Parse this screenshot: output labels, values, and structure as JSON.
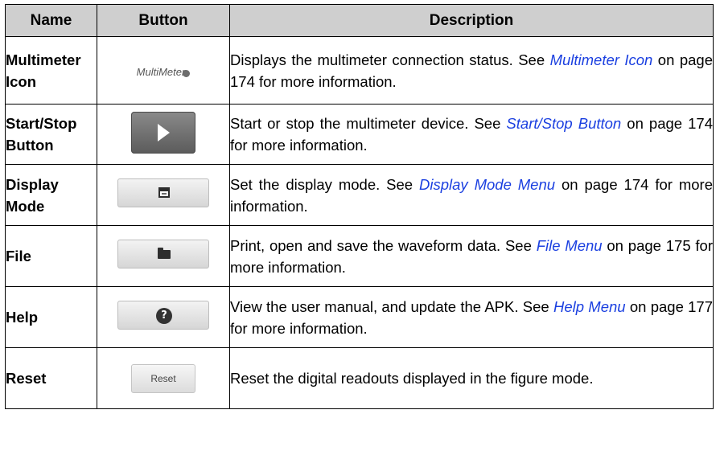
{
  "header": {
    "name": "Name",
    "button": "Button",
    "description": "Description"
  },
  "rows": [
    {
      "name": "Multimeter Icon",
      "button": {
        "kind": "multimeter-icon",
        "label": "MultiMeter"
      },
      "desc_pre": "Displays the multimeter connection status. See ",
      "link": "Multimeter Icon",
      "desc_post": " on page 174 for more information."
    },
    {
      "name": "Start/Stop Button",
      "button": {
        "kind": "play-icon"
      },
      "desc_pre": "Start or stop the multimeter device. See ",
      "link": "Start/Stop Button",
      "desc_post": " on page 174 for more information."
    },
    {
      "name": "Display Mode",
      "button": {
        "kind": "display-mode-icon"
      },
      "desc_pre": "Set the display mode. See ",
      "link": "Display Mode Menu",
      "desc_post": " on page 174 for more information."
    },
    {
      "name": "File",
      "button": {
        "kind": "folder-icon"
      },
      "desc_pre": "Print, open and save the waveform data. See ",
      "link": "File Menu",
      "desc_post": " on page 175 for more information."
    },
    {
      "name": "Help",
      "button": {
        "kind": "help-icon",
        "glyph": "?"
      },
      "desc_pre": "View the user manual, and update the APK. See ",
      "link": "Help Menu",
      "desc_post": " on page 177 for more information."
    },
    {
      "name": "Reset",
      "button": {
        "kind": "reset-button",
        "label": "Reset"
      },
      "desc_pre": "Reset the digital readouts displayed in the figure mode.",
      "link": "",
      "desc_post": ""
    }
  ],
  "colors": {
    "header_bg": "#cfcfcf",
    "link": "#1a3fe0",
    "border": "#000000"
  }
}
